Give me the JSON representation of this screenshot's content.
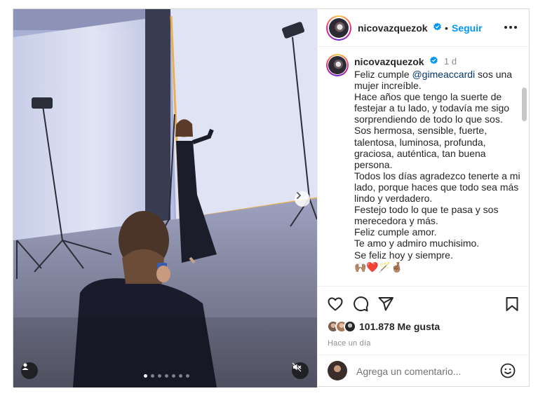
{
  "account": {
    "username": "nicovazquezok",
    "verified": true,
    "follow_label": "Seguir",
    "separator": "•"
  },
  "caption": {
    "username": "nicovazquezok",
    "time_ago": "1 d",
    "lines": [
      {
        "pre": "Feliz cumple ",
        "mention": "@gimeaccardi",
        "post": " sos una"
      },
      {
        "text": "mujer increíble."
      },
      {
        "text": "Hace años que tengo la suerte de"
      },
      {
        "text": "festejar a tu lado, y todavía me sigo"
      },
      {
        "text": "sorprendiendo de todo lo que sos."
      },
      {
        "text": "Sos hermosa, sensible, fuerte,"
      },
      {
        "text": "talentosa, luminosa, profunda,"
      },
      {
        "text": "graciosa, auténtica, tan buena"
      },
      {
        "text": "persona."
      },
      {
        "text": "Todos los días agradezco tenerte a mi"
      },
      {
        "text": "lado, porque haces que todo sea más"
      },
      {
        "text": "lindo y verdadero."
      },
      {
        "text": "Festejo todo lo que te pasa y sos"
      },
      {
        "text": "merecedora y más."
      },
      {
        "text": "Feliz cumple amor."
      },
      {
        "text": "Te amo y admiro muchisimo."
      },
      {
        "text": "Se feliz hoy y siempre."
      }
    ],
    "emojis": "🙌🏽❤️🪄🤞🏽"
  },
  "stats": {
    "likes": "101.878 Me gusta",
    "posted_ago": "Hace un día"
  },
  "comment": {
    "placeholder": "Agrega un comentario..."
  },
  "media": {
    "carousel_count": 7,
    "active_index": 0
  },
  "icons": {
    "like": "heart-icon",
    "comment": "comment-bubble-icon",
    "share": "paper-plane-icon",
    "save": "bookmark-icon",
    "more": "more-horizontal-icon",
    "next": "chevron-right-icon",
    "tags": "user-tag-icon",
    "audio": "muted-speaker-icon",
    "emoji": "smiley-face-icon",
    "verified": "verified-badge-icon"
  },
  "colors": {
    "accent": "#0095f6",
    "verified": "#0095f6",
    "mention": "#00376b",
    "secondary_text": "#8e8e8e"
  }
}
